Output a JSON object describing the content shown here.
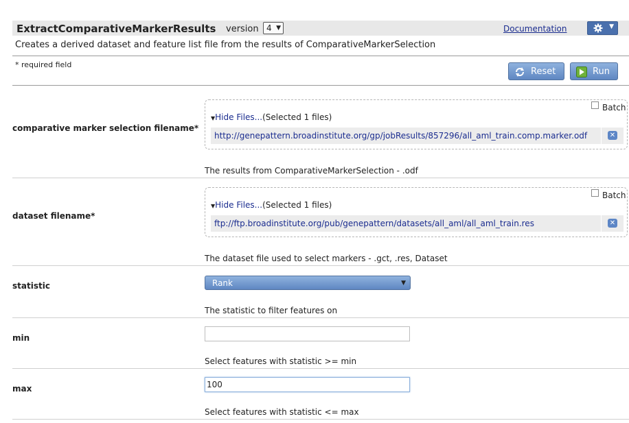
{
  "header": {
    "title": "ExtractComparativeMarkerResults",
    "version_label": "version",
    "version_value": "4",
    "doc_link": "Documentation"
  },
  "description": "Creates a derived dataset and feature list file from the results of ComparativeMarkerSelection",
  "required_note": "* required field",
  "buttons": {
    "reset": "Reset",
    "run": "Run"
  },
  "params": [
    {
      "label": "comparative marker selection filename*",
      "batch_label": "Batch",
      "hide_files": "Hide Files...",
      "selected": "(Selected 1 files)",
      "file": "http://genepattern.broadinstitute.org/gp/jobResults/857296/all_aml_train.comp.marker.odf",
      "help": "The results from ComparativeMarkerSelection - .odf"
    },
    {
      "label": "dataset filename*",
      "batch_label": "Batch",
      "hide_files": "Hide Files...",
      "selected": "(Selected 1 files)",
      "file": "ftp://ftp.broadinstitute.org/pub/genepattern/datasets/all_aml/all_aml_train.res",
      "help": "The dataset file used to select markers - .gct, .res, Dataset"
    },
    {
      "label": "statistic",
      "value": "Rank",
      "help": "The statistic to filter features on"
    },
    {
      "label": "min",
      "value": "",
      "help": "Select features with statistic >= min"
    },
    {
      "label": "max",
      "value": "100",
      "help": "Select features with statistic <= max"
    }
  ],
  "colors": {
    "header_bg": "#e8e8e8",
    "button_blue": "#5f87c2",
    "link": "#1a2c8f"
  }
}
